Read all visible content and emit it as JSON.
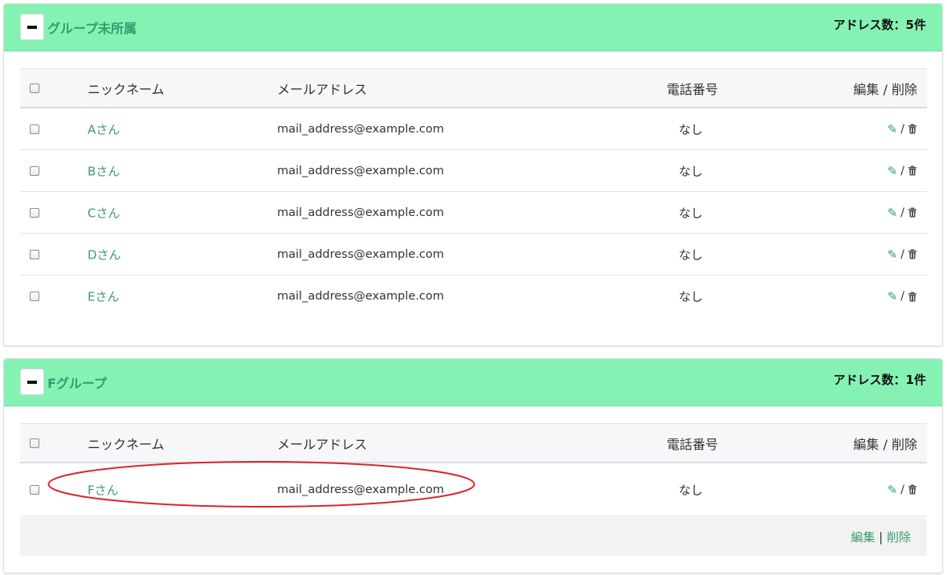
{
  "groups": [
    {
      "title": "グループ未所属",
      "count_text": "アドレス数：5件",
      "columns": {
        "nickname": "ニックネーム",
        "email": "メールアドレス",
        "phone": "電話番号",
        "actions": "編集 / 削除"
      },
      "rows": [
        {
          "nickname": "Aさん",
          "email": "mail_address@example.com",
          "phone": "なし"
        },
        {
          "nickname": "Bさん",
          "email": "mail_address@example.com",
          "phone": "なし"
        },
        {
          "nickname": "Cさん",
          "email": "mail_address@example.com",
          "phone": "なし"
        },
        {
          "nickname": "Dさん",
          "email": "mail_address@example.com",
          "phone": "なし"
        },
        {
          "nickname": "Eさん",
          "email": "mail_address@example.com",
          "phone": "なし"
        }
      ]
    },
    {
      "title": "Fグループ",
      "count_text": "アドレス数：1件",
      "columns": {
        "nickname": "ニックネーム",
        "email": "メールアドレス",
        "phone": "電話番号",
        "actions": "編集 / 削除"
      },
      "rows": [
        {
          "nickname": "Fさん",
          "email": "mail_address@example.com",
          "phone": "なし"
        }
      ],
      "footer": {
        "edit_label": "編集",
        "separator": "|",
        "delete_label": "削除"
      }
    }
  ],
  "row_action_separator": "/",
  "icons": {
    "collapse": "minus-icon",
    "edit": "pencil-icon",
    "delete": "trash-icon"
  },
  "colors": {
    "header_bg": "#85f2b4",
    "link": "#3a9d6d",
    "annotation": "#d9262b"
  }
}
